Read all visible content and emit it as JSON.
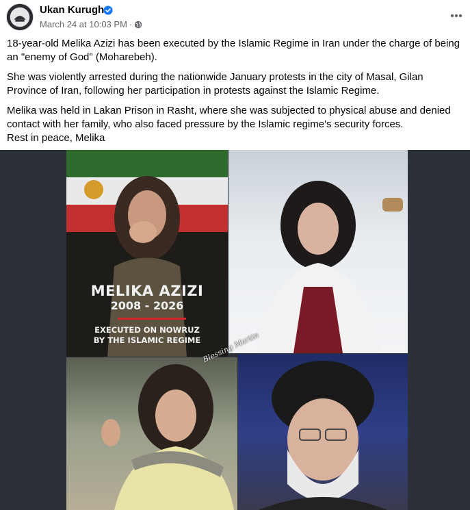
{
  "post": {
    "author": "Ukan Kurugh",
    "timestamp": "March 24 at 10:03 PM",
    "separator": "·",
    "paragraphs": [
      "18-year-old Melika Azizi has been executed by the Islamic Regime in Iran under the charge of being an \"enemy of God\" (Moharebeh).",
      "She was violently arrested during the nationwide January protests in the city of Masal, Gilan Province of Iran, following her participation in protests against the Islamic Regime.",
      "Melika was held in Lakan Prison in Rasht, where she was subjected to physical abuse and denied contact with her family, who also faced pressure by the Islamic regime's security forces.",
      "Rest in peace, Melika"
    ]
  },
  "image": {
    "overlay_name": "MELIKA AZIZI",
    "overlay_years": "2008 - 2026",
    "overlay_line1": "EXECUTED ON NOWRUZ",
    "overlay_line2": "BY THE ISLAMIC REGIME",
    "watermark": "Blessing Martin"
  },
  "icons": {
    "avatar": "profile-avatar",
    "verified": "verified-badge-icon",
    "audience": "globe-icon",
    "more": "more-options-icon"
  },
  "colors": {
    "verified": "#1877f2",
    "meta_text": "#65676b",
    "accent_bar": "#d6262c",
    "media_bg": "#2c3038"
  }
}
